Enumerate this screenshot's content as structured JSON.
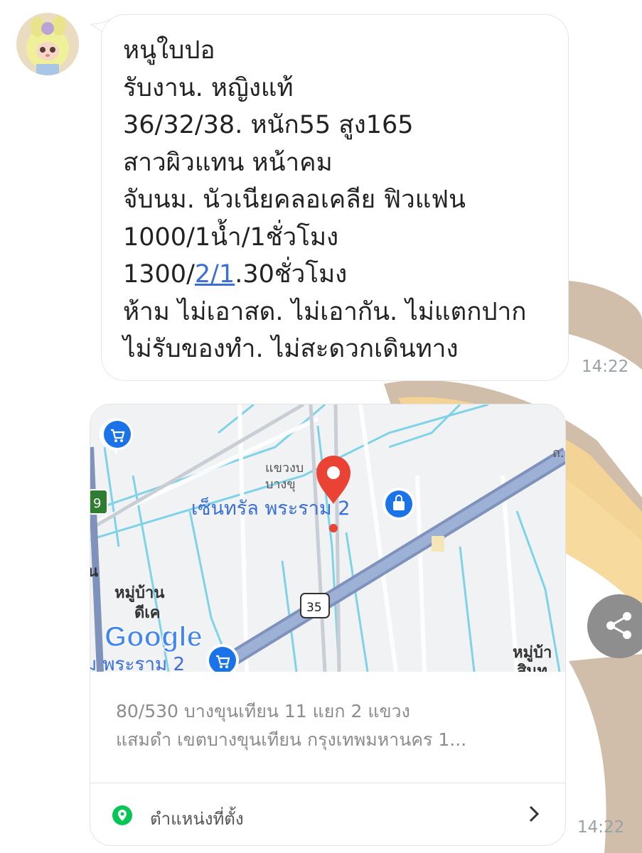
{
  "message": {
    "sender_avatar": "plush-doll-avatar",
    "lines": [
      "หนูใบปอ",
      "รับงาน. หญิงแท้",
      "36/32/38. หนัก55  สูง165",
      "สาวผิวแทน  หน้าคม",
      "จับนม. นัวเนียคลอเคลีย  ฟิวแฟน",
      "1000/1น้ำ/1ชั่วโมง"
    ],
    "line7_prefix": "1300/",
    "line7_link": "2/1",
    "line7_suffix": ".30ชั่วโมง",
    "lines_after": [
      "ห้าม  ไม่เอาสด. ไม่เอากัน. ไม่แตกปาก",
      "ไม่รับของทำ. ไม่สะดวกเดินทาง"
    ],
    "time": "14:22"
  },
  "location_card": {
    "map": {
      "labels": {
        "district": "แขวงบางขุน",
        "district_line1": "แขวงบ",
        "district_line2": "บางขุ",
        "mall": "เซ็นทรัล พระราม 2",
        "village_left_1": "หมู่บ้าน",
        "village_left_2": "ดีเค",
        "village_right_1": "หมู่บ้า",
        "village_right_2": "สินท",
        "bottom_road": "ม พระราม 2",
        "left_edge": "น",
        "route_35": "35",
        "route_9": "9",
        "road_top_right": "ถ.",
        "google": "Google"
      },
      "icons": [
        "cart-icon",
        "shopping-bag-icon",
        "map-pin-icon"
      ],
      "colors": {
        "pin": "#ea4335",
        "poi_blue": "#1a73e8",
        "highway": "#8fa2c6",
        "water": "#7fd3e8",
        "map_text": "#3a6fd8"
      }
    },
    "address_line1": "80/530 บางขุนเทียน 11 แยก 2 แขวง",
    "address_line2": "แสมดำ เขตบางขุนเทียน กรุงเทพมหานคร 1...",
    "footer_label": "ตำแหน่งที่ตั้ง",
    "time": "14:22"
  },
  "share_icon": "share-icon"
}
